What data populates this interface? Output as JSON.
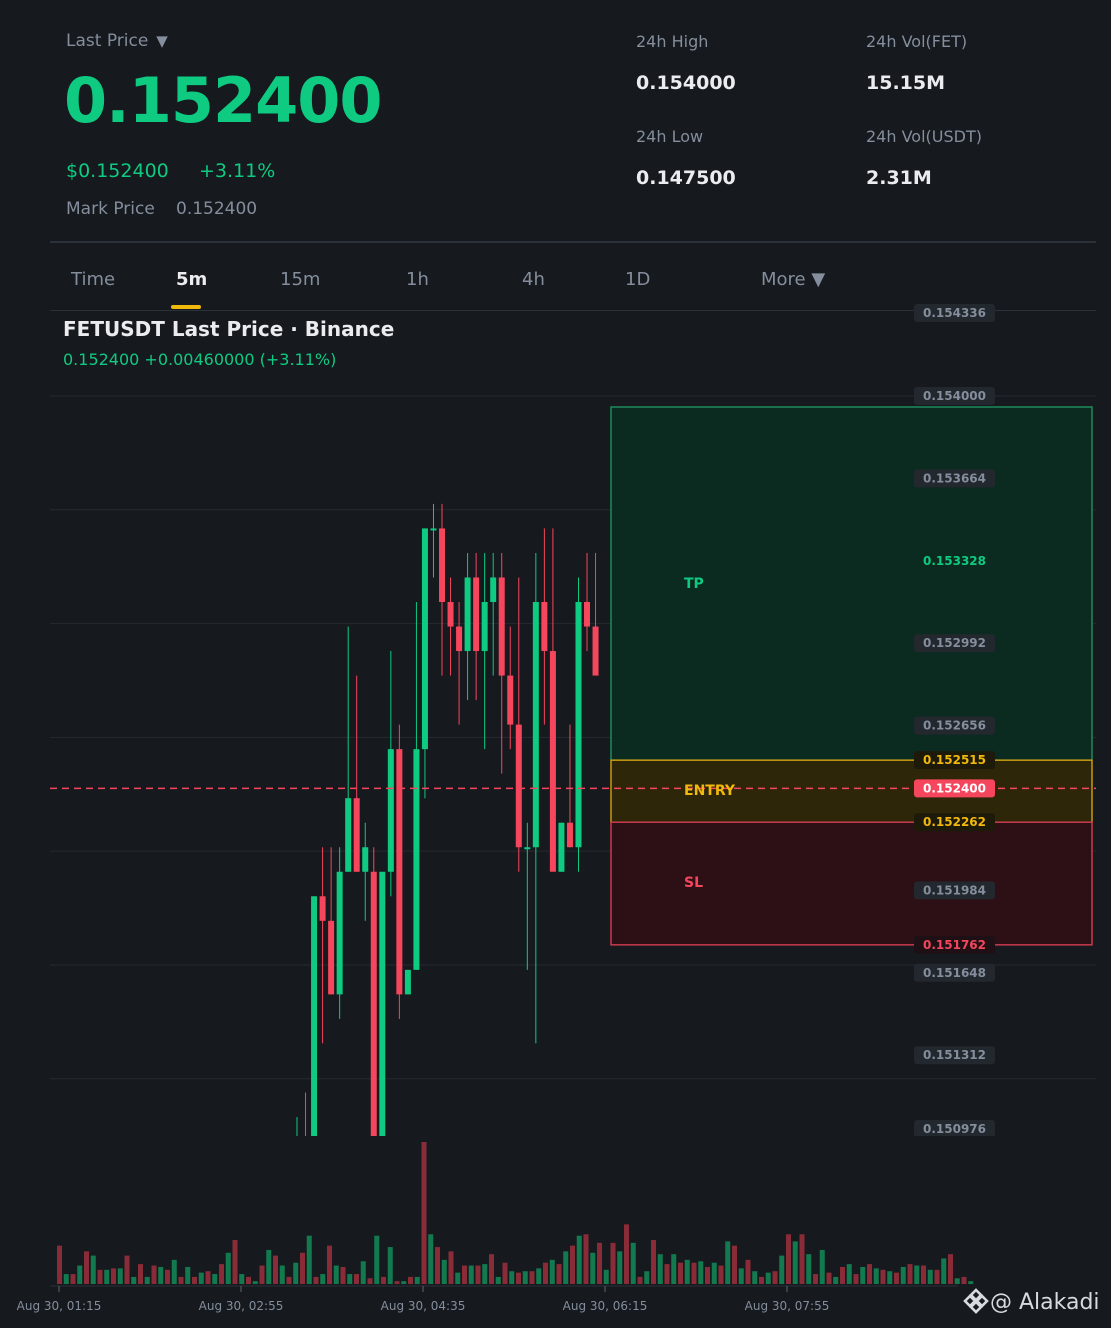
{
  "header": {
    "last_price_label": "Last Price",
    "caret": "▼",
    "last_price": "0.152400",
    "usd_price": "$0.152400",
    "change_pct": "+3.11%",
    "mark_price_label": "Mark Price",
    "mark_price": "0.152400"
  },
  "stats": [
    {
      "label": "24h High",
      "value": "0.154000"
    },
    {
      "label": "24h Vol(FET)",
      "value": "15.15M"
    },
    {
      "label": "24h Low",
      "value": "0.147500"
    },
    {
      "label": "24h Vol(USDT)",
      "value": "2.31M"
    }
  ],
  "tabs": [
    {
      "label": "Time",
      "active": false
    },
    {
      "label": "5m",
      "active": true
    },
    {
      "label": "15m",
      "active": false
    },
    {
      "label": "1h",
      "active": false
    },
    {
      "label": "4h",
      "active": false
    },
    {
      "label": "1D",
      "active": false
    },
    {
      "label": "More ▼",
      "active": false
    }
  ],
  "chart_title": "FETUSDT Last Price · Binance",
  "chart_subtitle": "0.152400  +0.00460000 (+3.11%)",
  "colors": {
    "up": "#0ecb81",
    "down": "#f6465d",
    "entry": "#f0b90b",
    "background": "#16191e",
    "text_muted": "#848e9c"
  },
  "brand": {
    "icon": "binance-logo-icon",
    "text": "@ Alakadi"
  },
  "chart_data": {
    "type": "candlestick",
    "title": "FETUSDT Last Price · Binance",
    "interval": "5m",
    "ylim": [
      0.15087,
      0.15455
    ],
    "y_ticks": [
      "0.154336",
      "0.154000",
      "0.153664",
      "0.153328",
      "0.152992",
      "0.152656",
      "0.152515",
      "0.152400",
      "0.152262",
      "0.151984",
      "0.151762",
      "0.151648",
      "0.151312",
      "0.150976"
    ],
    "x_ticks": [
      "Aug 30, 01:15",
      "Aug 30, 02:55",
      "Aug 30, 04:35",
      "Aug 30, 06:15",
      "Aug 30, 07:55"
    ],
    "levels": {
      "tp": {
        "label": "TP",
        "value": 0.154
      },
      "entry": {
        "label": "ENTRY",
        "value": 0.152515,
        "lower": 0.152262
      },
      "sl": {
        "label": "SL",
        "value": 0.151762
      },
      "last": 0.1524
    },
    "candles": [
      {
        "o": 0.15096,
        "h": 0.15106,
        "l": 0.15096,
        "c": 0.15098
      },
      {
        "o": 0.15098,
        "h": 0.15116,
        "l": 0.15092,
        "c": 0.15092
      },
      {
        "o": 0.15096,
        "h": 0.15196,
        "l": 0.15096,
        "c": 0.15196
      },
      {
        "o": 0.15196,
        "h": 0.15216,
        "l": 0.15136,
        "c": 0.15186
      },
      {
        "o": 0.15186,
        "h": 0.15216,
        "l": 0.15156,
        "c": 0.15156
      },
      {
        "o": 0.15156,
        "h": 0.15216,
        "l": 0.15146,
        "c": 0.15206
      },
      {
        "o": 0.15206,
        "h": 0.15306,
        "l": 0.15206,
        "c": 0.15236
      },
      {
        "o": 0.15236,
        "h": 0.15286,
        "l": 0.15206,
        "c": 0.15206
      },
      {
        "o": 0.15206,
        "h": 0.15226,
        "l": 0.15186,
        "c": 0.15216
      },
      {
        "o": 0.15206,
        "h": 0.15216,
        "l": 0.15096,
        "c": 0.15096
      },
      {
        "o": 0.15096,
        "h": 0.15176,
        "l": 0.15096,
        "c": 0.15206
      },
      {
        "o": 0.15206,
        "h": 0.15296,
        "l": 0.15196,
        "c": 0.15256
      },
      {
        "o": 0.15256,
        "h": 0.15266,
        "l": 0.15146,
        "c": 0.15156
      },
      {
        "o": 0.15156,
        "h": 0.15166,
        "l": 0.15156,
        "c": 0.15166
      },
      {
        "o": 0.15166,
        "h": 0.15316,
        "l": 0.15166,
        "c": 0.15256
      },
      {
        "o": 0.15256,
        "h": 0.15346,
        "l": 0.15236,
        "c": 0.15346
      },
      {
        "o": 0.15346,
        "h": 0.15356,
        "l": 0.15326,
        "c": 0.15346
      },
      {
        "o": 0.15346,
        "h": 0.15356,
        "l": 0.15286,
        "c": 0.15316
      },
      {
        "o": 0.15316,
        "h": 0.15326,
        "l": 0.15286,
        "c": 0.15306
      },
      {
        "o": 0.15306,
        "h": 0.15316,
        "l": 0.15266,
        "c": 0.15296
      },
      {
        "o": 0.15296,
        "h": 0.15336,
        "l": 0.15276,
        "c": 0.15326
      },
      {
        "o": 0.15326,
        "h": 0.15336,
        "l": 0.15276,
        "c": 0.15296
      },
      {
        "o": 0.15296,
        "h": 0.15336,
        "l": 0.15256,
        "c": 0.15316
      },
      {
        "o": 0.15316,
        "h": 0.15336,
        "l": 0.15286,
        "c": 0.15326
      },
      {
        "o": 0.15326,
        "h": 0.15336,
        "l": 0.15246,
        "c": 0.15286
      },
      {
        "o": 0.15286,
        "h": 0.15306,
        "l": 0.15256,
        "c": 0.15266
      },
      {
        "o": 0.15266,
        "h": 0.15326,
        "l": 0.15206,
        "c": 0.15216
      },
      {
        "o": 0.15216,
        "h": 0.15226,
        "l": 0.15166,
        "c": 0.15216
      },
      {
        "o": 0.15216,
        "h": 0.15336,
        "l": 0.15136,
        "c": 0.15316
      },
      {
        "o": 0.15316,
        "h": 0.15346,
        "l": 0.15266,
        "c": 0.15296
      },
      {
        "o": 0.15296,
        "h": 0.15346,
        "l": 0.15246,
        "c": 0.15206
      },
      {
        "o": 0.15206,
        "h": 0.15226,
        "l": 0.15206,
        "c": 0.15226
      },
      {
        "o": 0.15226,
        "h": 0.15266,
        "l": 0.15216,
        "c": 0.15216
      },
      {
        "o": 0.15216,
        "h": 0.15326,
        "l": 0.15206,
        "c": 0.15316
      },
      {
        "o": 0.15316,
        "h": 0.15336,
        "l": 0.15296,
        "c": 0.15306
      },
      {
        "o": 0.15306,
        "h": 0.15336,
        "l": 0.15296,
        "c": 0.15286
      }
    ],
    "volume": {
      "ymax": 100
    }
  }
}
